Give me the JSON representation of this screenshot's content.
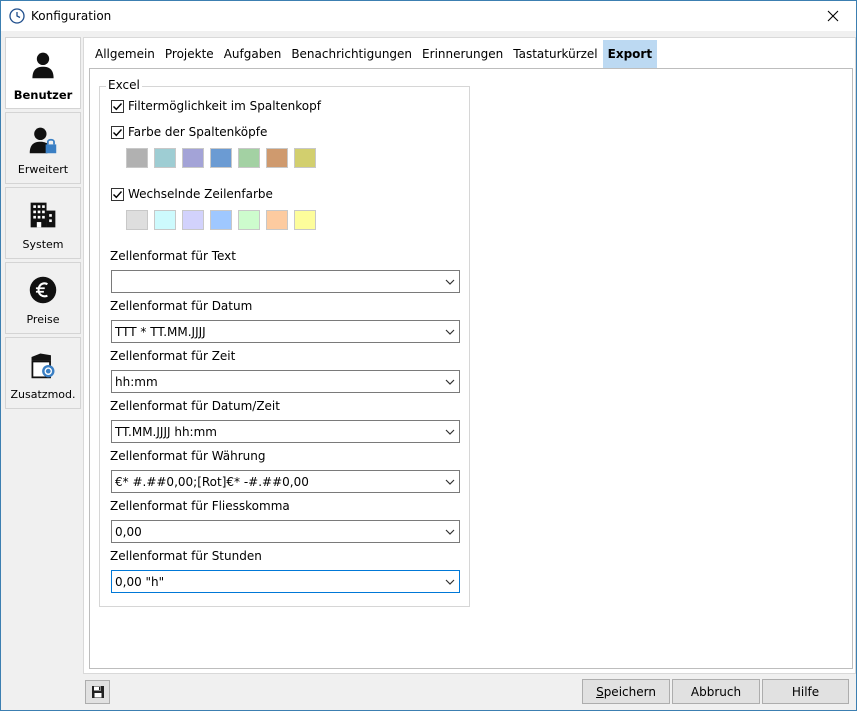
{
  "window": {
    "title": "Konfiguration"
  },
  "nav": {
    "items": [
      {
        "label": "Benutzer",
        "icon": "user-icon",
        "active": true
      },
      {
        "label": "Erweitert",
        "icon": "user-lock-icon",
        "active": false
      },
      {
        "label": "System",
        "icon": "building-icon",
        "active": false
      },
      {
        "label": "Preise",
        "icon": "euro-icon",
        "active": false
      },
      {
        "label": "Zusatzmod.",
        "icon": "package-module-icon",
        "active": false
      }
    ]
  },
  "tabs": [
    "Allgemein",
    "Projekte",
    "Aufgaben",
    "Benachrichtigungen",
    "Erinnerungen",
    "Tastaturkürzel",
    "Export"
  ],
  "active_tab": "Export",
  "excel": {
    "group_title": "Excel",
    "filter_label": "Filtermöglichkeit im Spaltenkopf",
    "filter_checked": true,
    "header_color_label": "Farbe der Spaltenköpfe",
    "header_color_checked": true,
    "header_colors": [
      "#b1b1b1",
      "#9ecdd3",
      "#a3a3d7",
      "#6b9bd3",
      "#a3d1a3",
      "#cf9a6e",
      "#d2cf6e"
    ],
    "alt_row_label": "Wechselnde Zeilenfarbe",
    "alt_row_checked": true,
    "alt_row_colors": [
      "#dedede",
      "#cdfafd",
      "#d2d2fc",
      "#9fc8ff",
      "#cdfccd",
      "#fdcba0",
      "#fdfd9b"
    ],
    "fields": [
      {
        "label": "Zellenformat für Text",
        "value": ""
      },
      {
        "label": "Zellenformat für Datum",
        "value": "TTT * TT.MM.JJJJ"
      },
      {
        "label": "Zellenformat für Zeit",
        "value": "hh:mm"
      },
      {
        "label": "Zellenformat für Datum/Zeit",
        "value": "TT.MM.JJJJ hh:mm"
      },
      {
        "label": "Zellenformat für Währung",
        "value": "€* #.##0,00;[Rot]€* -#.##0,00"
      },
      {
        "label": "Zellenformat für Fliesskomma",
        "value": "0,00"
      },
      {
        "label": "Zellenformat für Stunden",
        "value": "0,00 \"h\""
      }
    ]
  },
  "buttons": {
    "save_first": "S",
    "save_rest": "peichern",
    "cancel": "Abbruch",
    "help": "Hilfe"
  },
  "colors": {
    "accent": "#0078d7",
    "tab_active": "#bcd9f2"
  }
}
